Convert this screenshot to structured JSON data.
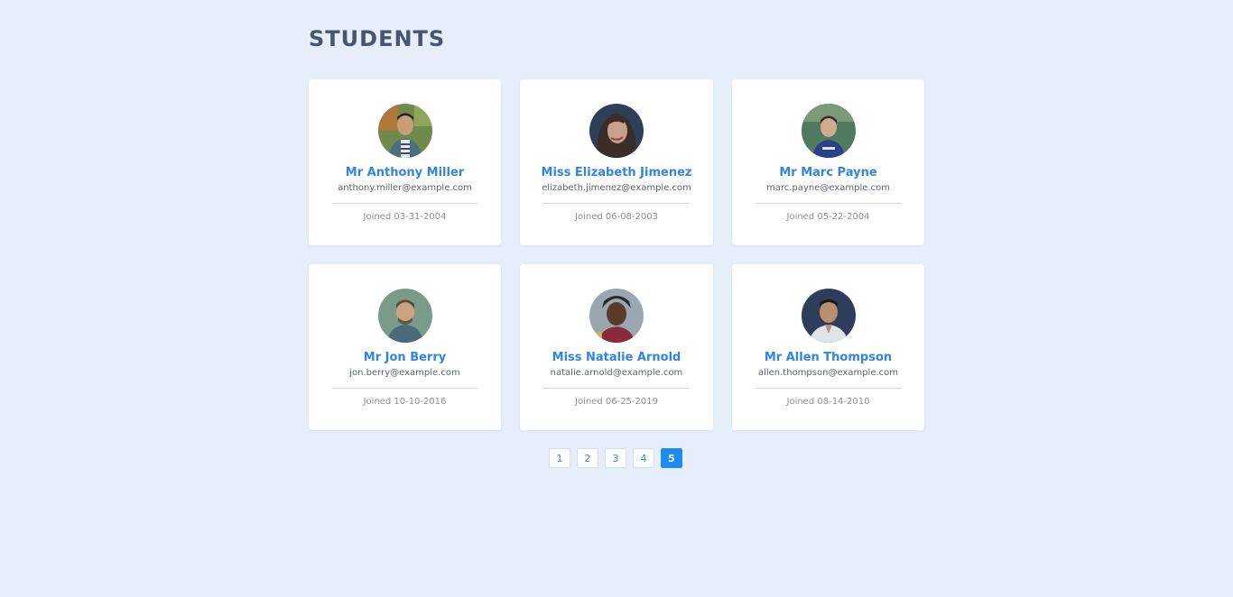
{
  "page": {
    "title": "STUDENTS"
  },
  "students": [
    {
      "name": "Mr Anthony Miller",
      "email": "anthony.miller@example.com",
      "joined": "Joined 03-31-2004"
    },
    {
      "name": "Miss Elizabeth Jimenez",
      "email": "elizabeth.jimenez@example.com",
      "joined": "Joined 06-08-2003"
    },
    {
      "name": "Mr Marc Payne",
      "email": "marc.payne@example.com",
      "joined": "Joined 05-22-2004"
    },
    {
      "name": "Mr Jon Berry",
      "email": "jon.berry@example.com",
      "joined": "Joined 10-10-2016"
    },
    {
      "name": "Miss Natalie Arnold",
      "email": "natalie.arnold@example.com",
      "joined": "Joined 06-25-2019"
    },
    {
      "name": "Mr Allen Thompson",
      "email": "allen.thompson@example.com",
      "joined": "Joined 08-14-2010"
    }
  ],
  "pagination": {
    "pages": [
      "1",
      "2",
      "3",
      "4",
      "5"
    ],
    "current": "5"
  },
  "colors": {
    "background": "#e6eefa",
    "accent": "#2f84e8",
    "active_page": "#1e8cf3",
    "title": "#46566e"
  }
}
